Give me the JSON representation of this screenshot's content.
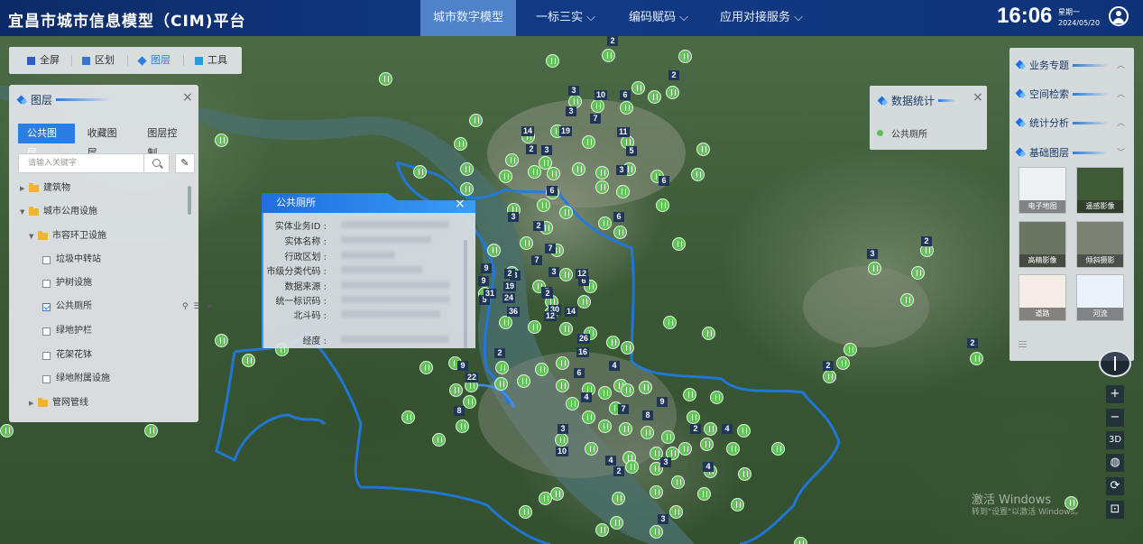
{
  "header": {
    "title": "宜昌市城市信息模型（CIM)平台",
    "nav": [
      {
        "label": "城市数字模型",
        "active": true
      },
      {
        "label": "一标三实 ⌵",
        "active": false
      },
      {
        "label": "编码赋码 ⌵",
        "active": false
      },
      {
        "label": "应用对接服务 ⌵",
        "active": false
      }
    ],
    "time": "16:06",
    "weekday": "星期一",
    "date": "2024/05/20"
  },
  "toolbar": {
    "items": [
      {
        "label": "全屏",
        "icon": "fullscreen-icon",
        "active": false
      },
      {
        "label": "区划",
        "icon": "district-icon",
        "active": false
      },
      {
        "label": "图层",
        "icon": "layers-icon",
        "active": true
      },
      {
        "label": "工具",
        "icon": "toolbox-icon",
        "active": false
      }
    ]
  },
  "layer_panel": {
    "title": "图层",
    "tabs": [
      "公共图层",
      "收藏图层",
      "图层控制"
    ],
    "active_tab": 0,
    "search_placeholder": "请输入关键字",
    "tree": [
      {
        "label": "建筑物",
        "kind": "folder",
        "expanded": false
      },
      {
        "label": "城市公用设施",
        "kind": "folder",
        "expanded": true
      },
      {
        "label": "市容环卫设施",
        "kind": "folder",
        "expanded": true
      },
      {
        "label": "垃圾中转站",
        "kind": "check",
        "checked": false
      },
      {
        "label": "护树设施",
        "kind": "check",
        "checked": false
      },
      {
        "label": "公共厕所",
        "kind": "check",
        "checked": true
      },
      {
        "label": "绿地护栏",
        "kind": "check",
        "checked": false
      },
      {
        "label": "花架花钵",
        "kind": "check",
        "checked": false
      },
      {
        "label": "绿地附属设施",
        "kind": "check",
        "checked": false
      },
      {
        "label": "管网管线",
        "kind": "folder",
        "expanded": false
      }
    ],
    "row_icons": [
      "locate-icon",
      "list-icon",
      "star-icon"
    ]
  },
  "popup": {
    "title": "公共厕所",
    "fields": [
      {
        "label": "实体业务ID :"
      },
      {
        "label": "实体名称 :"
      },
      {
        "label": "行政区划 :"
      },
      {
        "label": "市级分类代码 :"
      },
      {
        "label": "数据来源 :"
      },
      {
        "label": "统一标识码 :"
      },
      {
        "label": "北斗码 :"
      },
      {
        "label": "经度 :"
      }
    ]
  },
  "stats_panel": {
    "title": "数据统计",
    "items": [
      {
        "label": "公共厕所"
      }
    ]
  },
  "right_panel": {
    "sections": [
      {
        "label": "业务专题",
        "chevron": "︿"
      },
      {
        "label": "空间检索",
        "chevron": "︿"
      },
      {
        "label": "统计分析",
        "chevron": "︿"
      },
      {
        "label": "基础图层",
        "chevron": "﹀"
      }
    ],
    "basemaps": [
      {
        "label": "电子地图",
        "color": "#eef1f4"
      },
      {
        "label": "遥感影像",
        "color": "#3f5a36"
      },
      {
        "label": "高精影像",
        "color": "#6b7563"
      },
      {
        "label": "倾斜摄影",
        "color": "#7b8274"
      },
      {
        "label": "道路",
        "color": "#f4ede6"
      },
      {
        "label": "河流",
        "color": "#eaf3fb"
      }
    ]
  },
  "map_controls": [
    "+",
    "−",
    "3D",
    "◍",
    "⟳",
    "⊡"
  ],
  "watermark": {
    "line1": "激活 Windows",
    "line2": "转到\"设置\"以激活 Windows。"
  },
  "map": {
    "pin_counts": [
      "2",
      "2",
      "3",
      "10",
      "6",
      "3",
      "7",
      "19",
      "14",
      "11",
      "2",
      "3",
      "5",
      "3",
      "6",
      "6",
      "3",
      "2",
      "6",
      "7",
      "3",
      "7",
      "9",
      "2",
      "5",
      "3",
      "6",
      "9",
      "19",
      "30",
      "12",
      "24",
      "5",
      "31",
      "36",
      "12",
      "2",
      "14",
      "26",
      "16",
      "9",
      "22",
      "2",
      "4",
      "6",
      "4",
      "9",
      "8",
      "7",
      "8",
      "4",
      "10",
      "2",
      "4",
      "2",
      "3",
      "4",
      "3",
      "2",
      "2",
      "3",
      "2",
      "3"
    ]
  }
}
